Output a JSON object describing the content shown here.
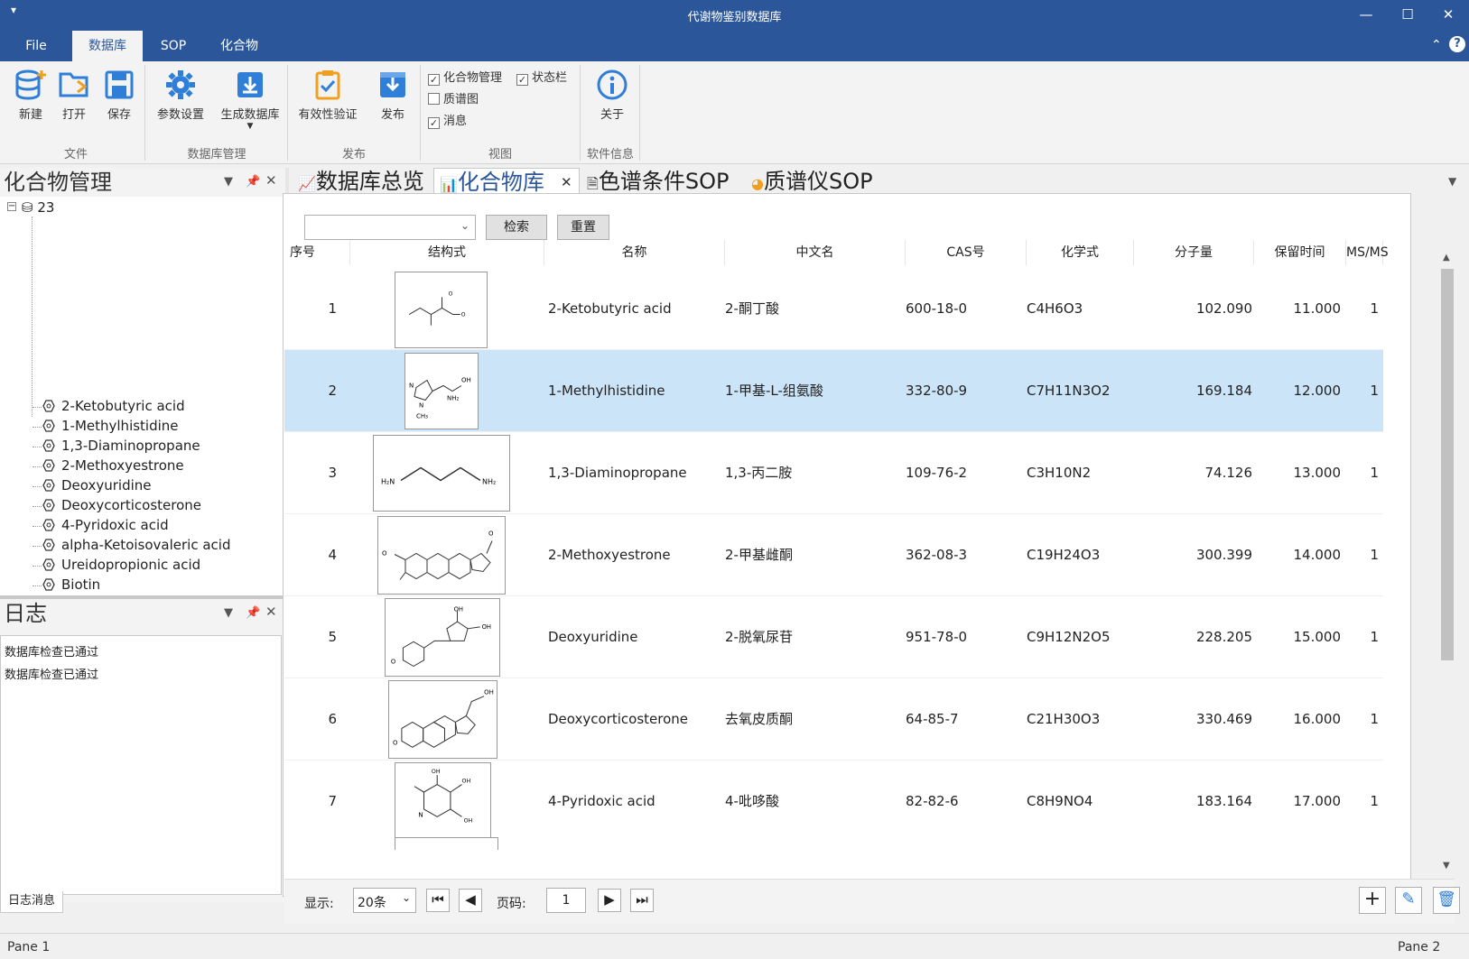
{
  "window": {
    "title": "代谢物鉴别数据库",
    "quick_access": "▾"
  },
  "menu": {
    "tabs": [
      "File",
      "数据库",
      "SOP",
      "化合物"
    ],
    "active": "数据库"
  },
  "ribbon": {
    "buttons": [
      "新建",
      "打开",
      "保存",
      "参数设置",
      "生成数据库",
      "有效性验证",
      "发布",
      "关于"
    ],
    "groups": [
      "文件",
      "数据库管理",
      "发布",
      "视图",
      "软件信息"
    ],
    "view_checks": [
      {
        "label": "化合物管理",
        "checked": true
      },
      {
        "label": "状态栏",
        "checked": true
      },
      {
        "label": "质谱图",
        "checked": false
      },
      {
        "label": "消息",
        "checked": true
      }
    ]
  },
  "compound_panel": {
    "title": "化合物管理",
    "root": "23",
    "items": [
      "2-Ketobutyric acid",
      "1-Methylhistidine",
      "1,3-Diaminopropane",
      "2-Methoxyestrone",
      "Deoxyuridine",
      "Deoxycorticosterone",
      "4-Pyridoxic acid",
      "alpha-Ketoisovaleric acid",
      "Ureidopropionic acid",
      "Biotin"
    ]
  },
  "log_panel": {
    "title": "日志",
    "messages": [
      "数据库检查已通过",
      "数据库检查已通过"
    ],
    "tab": "日志消息"
  },
  "doc_tabs": [
    "数据库总览",
    "化合物库",
    "色谱条件SOP",
    "质谱仪SOP"
  ],
  "active_doc_tab": "化合物库",
  "search": {
    "value": "",
    "search_label": "检索",
    "reset_label": "重置"
  },
  "grid": {
    "columns": [
      "序号",
      "结构式",
      "名称",
      "中文名",
      "CAS号",
      "化学式",
      "分子量",
      "保留时间",
      "MS/MS"
    ],
    "rows": [
      {
        "no": "1",
        "name": "2-Ketobutyric acid",
        "cn": "2-酮丁酸",
        "cas": "600-18-0",
        "formula": "C4H6O3",
        "mw": "102.090",
        "rt": "11.000",
        "ms": "1"
      },
      {
        "no": "2",
        "name": "1-Methylhistidine",
        "cn": "1-甲基-L-组氨酸",
        "cas": "332-80-9",
        "formula": "C7H11N3O2",
        "mw": "169.184",
        "rt": "12.000",
        "ms": "1"
      },
      {
        "no": "3",
        "name": "1,3-Diaminopropane",
        "cn": "1,3-丙二胺",
        "cas": "109-76-2",
        "formula": "C3H10N2",
        "mw": "74.126",
        "rt": "13.000",
        "ms": "1"
      },
      {
        "no": "4",
        "name": "2-Methoxyestrone",
        "cn": "2-甲基雌酮",
        "cas": "362-08-3",
        "formula": "C19H24O3",
        "mw": "300.399",
        "rt": "14.000",
        "ms": "1"
      },
      {
        "no": "5",
        "name": "Deoxyuridine",
        "cn": "2-脱氧尿苷",
        "cas": "951-78-0",
        "formula": "C9H12N2O5",
        "mw": "228.205",
        "rt": "15.000",
        "ms": "1"
      },
      {
        "no": "6",
        "name": "Deoxycorticosterone",
        "cn": "去氧皮质酮",
        "cas": "64-85-7",
        "formula": "C21H30O3",
        "mw": "330.469",
        "rt": "16.000",
        "ms": "1"
      },
      {
        "no": "7",
        "name": "4-Pyridoxic acid",
        "cn": "4-吡哆酸",
        "cas": "82-82-6",
        "formula": "C8H9NO4",
        "mw": "183.164",
        "rt": "17.000",
        "ms": "1"
      }
    ],
    "selected_row": 2
  },
  "pager": {
    "show_label": "显示:",
    "page_size": "20条",
    "page_label": "页码:",
    "page": "1"
  },
  "status": {
    "left": "Pane 1",
    "right": "Pane 2"
  },
  "colors": {
    "accent": "#2b579a",
    "selection": "#cce4f7",
    "icon_blue": "#2f7fd8"
  },
  "icons": [
    "database-new-icon",
    "folder-open-icon",
    "save-icon",
    "gear-icon",
    "generate-db-icon",
    "clipboard-check-icon",
    "publish-icon",
    "info-icon"
  ]
}
